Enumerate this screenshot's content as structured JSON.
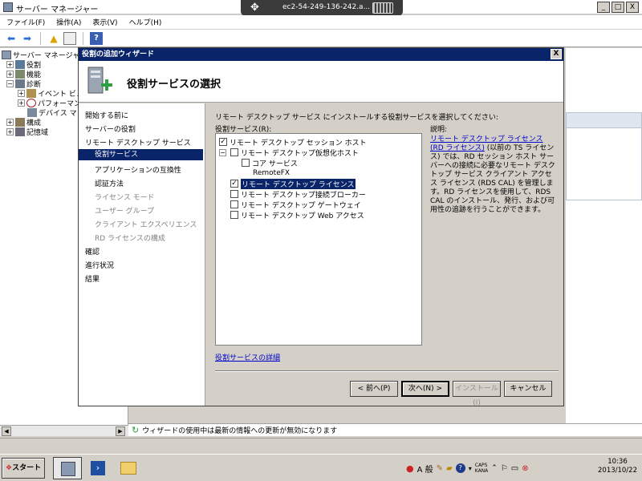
{
  "window": {
    "title": "サーバー マネージャー",
    "min_glyph": "_",
    "max_glyph": "□",
    "close_glyph": "X"
  },
  "rdp": {
    "host": "ec2-54-249-136-242.a..."
  },
  "menu": [
    "ファイル(F)",
    "操作(A)",
    "表示(V)",
    "ヘルプ(H)"
  ],
  "tree": {
    "root": "サーバー マネージャ",
    "items": [
      {
        "label": "役割",
        "expander": "+"
      },
      {
        "label": "機能",
        "expander": "+"
      },
      {
        "label": "診断",
        "expander": "−"
      },
      {
        "label": "イベント ビュ",
        "expander": "+"
      },
      {
        "label": "パフォーマン",
        "expander": "+"
      },
      {
        "label": "デバイス マ",
        "expander": ""
      },
      {
        "label": "構成",
        "expander": "+"
      },
      {
        "label": "記憶域",
        "expander": "+"
      }
    ]
  },
  "dialog": {
    "title": "役割の追加ウィザード",
    "close_glyph": "X",
    "header_title": "役割サービスの選択",
    "steps": [
      {
        "label": "開始する前に",
        "state": "normal"
      },
      {
        "label": "サーバーの役割",
        "state": "normal"
      },
      {
        "label": "リモート デスクトップ サービス",
        "state": "normal"
      },
      {
        "label": "役割サービス",
        "state": "active"
      },
      {
        "label": "アプリケーションの互換性",
        "state": "normal"
      },
      {
        "label": "認証方法",
        "state": "normal"
      },
      {
        "label": "ライセンス モード",
        "state": "dim"
      },
      {
        "label": "ユーザー グループ",
        "state": "dim"
      },
      {
        "label": "クライアント エクスペリエンス",
        "state": "dim"
      },
      {
        "label": "RD ライセンスの構成",
        "state": "dim"
      },
      {
        "label": "確認",
        "state": "normal"
      },
      {
        "label": "進行状況",
        "state": "normal"
      },
      {
        "label": "結果",
        "state": "normal"
      }
    ],
    "instruction": "リモート デスクトップ サービス にインストールする役割サービスを選択してください:",
    "roles_label": "役割サービス(R):",
    "description_label": "説明:",
    "roles": [
      {
        "label": "リモート デスクトップ セッション ホスト",
        "checked": true,
        "selected": false,
        "toggle": ""
      },
      {
        "label": "リモート デスクトップ仮想化ホスト",
        "checked": false,
        "selected": false,
        "toggle": "−"
      },
      {
        "label": "コア サービス",
        "checked": false,
        "selected": false,
        "toggle": ""
      },
      {
        "label": "RemoteFX",
        "checked": false,
        "selected": false,
        "toggle": ""
      },
      {
        "label": "リモート デスクトップ ライセンス",
        "checked": true,
        "selected": true,
        "toggle": ""
      },
      {
        "label": "リモート デスクトップ接続ブローカー",
        "checked": false,
        "selected": false,
        "toggle": ""
      },
      {
        "label": "リモート デスクトップ ゲートウェイ",
        "checked": false,
        "selected": false,
        "toggle": ""
      },
      {
        "label": "リモート デスクトップ Web アクセス",
        "checked": false,
        "selected": false,
        "toggle": ""
      }
    ],
    "description_link": "リモート デスクトップ ライセンス (RD ライセンス)",
    "description_text": " (以前の TS ライセンス) では、RD セッション ホスト サーバーへの接続に必要なリモート デスクトップ サービス クライアント アクセス ライセンス (RDS CAL) を管理します。RD ライセンスを使用して、RDS CAL のインストール、発行、および可用性の追跡を行うことができます。",
    "details_link": "役割サービスの詳細",
    "buttons": {
      "prev": "< 前へ(P)",
      "next": "次へ(N) >",
      "install": "インストール(I)",
      "cancel": "キャンセル"
    }
  },
  "status": {
    "message": "ウィザードの使用中は最新の情報への更新が無効になります"
  },
  "taskbar": {
    "start_label": "スタート",
    "tray_ime": "A 般",
    "caps": "CAPS",
    "kana": "KANA",
    "time": "10:36",
    "date": "2013/10/22"
  }
}
